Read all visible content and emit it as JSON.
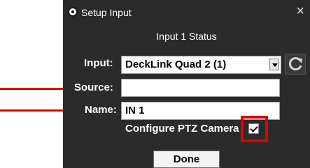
{
  "window": {
    "title": "Setup Input"
  },
  "status": {
    "text": "Input 1 Status"
  },
  "input": {
    "label": "Input:",
    "value": "DeckLink Quad 2 (1)"
  },
  "source": {
    "label": "Source:",
    "value": ""
  },
  "name": {
    "label": "Name:",
    "value": "IN 1"
  },
  "ptz": {
    "label": "Configure PTZ Camera",
    "checked": true
  },
  "buttons": {
    "done": "Done",
    "close": "×"
  },
  "colors": {
    "annotation": "#e00000",
    "dialog_bg": "#2b2b2b"
  },
  "icons": [
    "app-icon",
    "close-icon",
    "dropdown-arrow-icon",
    "refresh-icon",
    "checkmark-icon"
  ]
}
